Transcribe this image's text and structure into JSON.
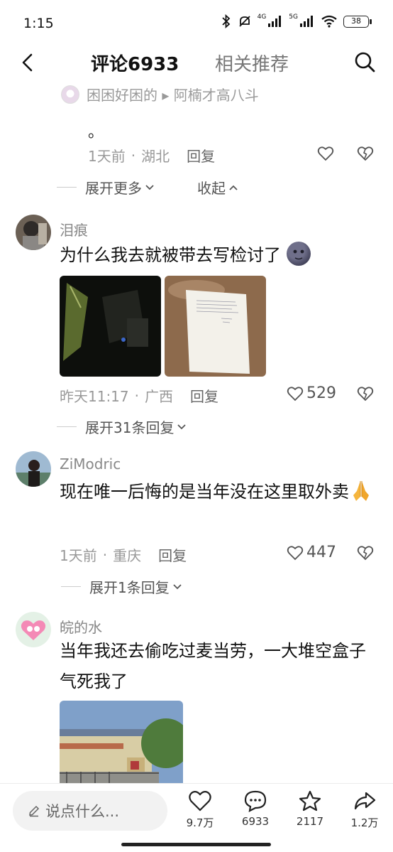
{
  "status": {
    "time": "1:15",
    "sig1": "4G",
    "sig2": "5G",
    "battery": "38"
  },
  "tabs": {
    "comments": "评论6933",
    "related": "相关推荐"
  },
  "reply": {
    "users": "困困好困的 ▸ 阿楠才高八斗",
    "text": "。",
    "time": "1天前",
    "sep": "·",
    "location": "湖北",
    "reply_label": "回复",
    "expand_more": "展开更多",
    "collapse": "收起"
  },
  "comments": [
    {
      "name": "泪痕",
      "text": "为什么我去就被带去写检讨了",
      "time": "昨天11:17",
      "sep": "·",
      "location": "广西",
      "reply_label": "回复",
      "likes": "529",
      "expand": "展开31条回复"
    },
    {
      "name": "ZiModric",
      "text": "现在唯一后悔的是当年没在这里取外卖",
      "time": "1天前",
      "sep": "·",
      "location": "重庆",
      "reply_label": "回复",
      "likes": "447",
      "expand": "展开1条回复"
    },
    {
      "name": "皖的水",
      "text": "当年我还去偷吃过麦当劳，一大堆空盒子气死我了"
    }
  ],
  "bottom": {
    "placeholder": "说点什么...",
    "likes": "9.7万",
    "comments": "6933",
    "favorites": "2117",
    "shares": "1.2万"
  }
}
